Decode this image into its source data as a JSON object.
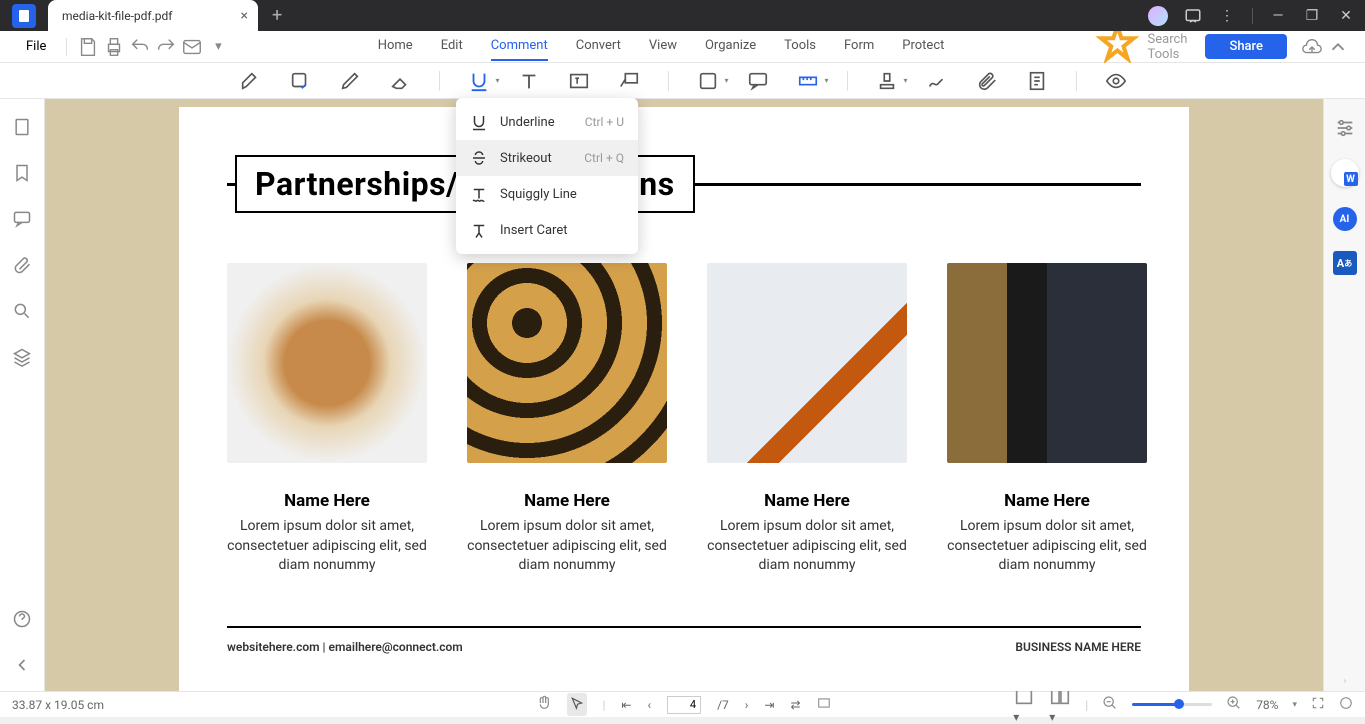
{
  "titlebar": {
    "tab_title": "media-kit-file-pdf.pdf"
  },
  "menubar": {
    "file": "File",
    "items": [
      "Home",
      "Edit",
      "Comment",
      "Convert",
      "View",
      "Organize",
      "Tools",
      "Form",
      "Protect"
    ],
    "active": "Comment",
    "search_placeholder": "Search Tools",
    "share": "Share"
  },
  "dropdown": {
    "items": [
      {
        "label": "Underline",
        "shortcut": "Ctrl + U"
      },
      {
        "label": "Strikeout",
        "shortcut": "Ctrl + Q"
      },
      {
        "label": "Squiggly Line",
        "shortcut": ""
      },
      {
        "label": "Insert Caret",
        "shortcut": ""
      }
    ],
    "hover_index": 1
  },
  "document": {
    "section_title": "Partnerships/Collaborations",
    "cards": [
      {
        "name": "Name Here",
        "desc": "Lorem ipsum dolor sit amet, consectetuer adipiscing elit, sed diam nonummy"
      },
      {
        "name": "Name Here",
        "desc": "Lorem ipsum dolor sit amet, consectetuer adipiscing elit, sed diam nonummy"
      },
      {
        "name": "Name Here",
        "desc": "Lorem ipsum dolor sit amet, consectetuer adipiscing elit, sed diam nonummy"
      },
      {
        "name": "Name Here",
        "desc": "Lorem ipsum dolor sit amet, consectetuer adipiscing elit, sed diam nonummy"
      }
    ],
    "footer_left": "websitehere.com    |    emailhere@connect.com",
    "footer_right": "BUSINESS NAME HERE"
  },
  "statusbar": {
    "dimensions": "33.87 x 19.05 cm",
    "page_current": "4",
    "page_total": "/7",
    "zoom": "78%"
  }
}
